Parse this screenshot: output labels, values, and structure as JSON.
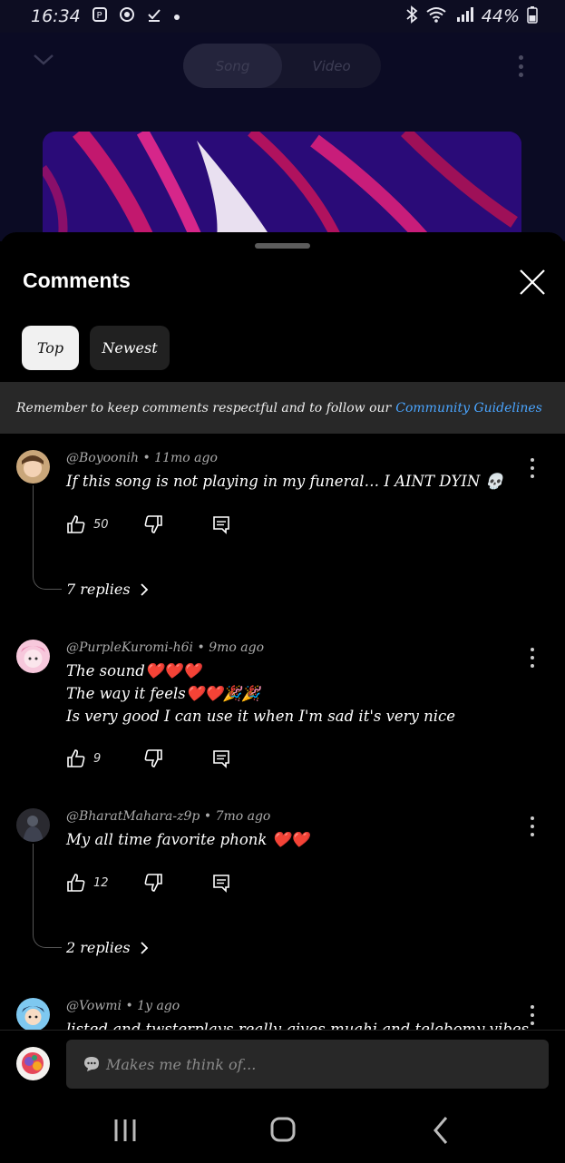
{
  "status_bar": {
    "time": "16:34",
    "battery": "44%",
    "icons": [
      "notification-p-icon",
      "circle-record-icon",
      "download-check-icon",
      "dot-icon",
      "bluetooth-icon",
      "wifi-icon",
      "signal-icon",
      "battery-icon"
    ]
  },
  "player": {
    "tabs": [
      {
        "label": "Song",
        "active": true
      },
      {
        "label": "Video",
        "active": false
      }
    ]
  },
  "comments_sheet": {
    "title": "Comments",
    "filters": [
      {
        "label": "Top",
        "selected": true
      },
      {
        "label": "Newest",
        "selected": false
      }
    ],
    "notice_text": "Remember to keep comments respectful and to follow our",
    "notice_link": "Community Guidelines",
    "comments": [
      {
        "author": "@Boyoonih",
        "age": "11mo ago",
        "lines": [
          "If this song is not playing in my funeral… I AINT DYIN 💀"
        ],
        "likes": "50",
        "replies": "7 replies"
      },
      {
        "author": "@PurpleKuromi-h6i",
        "age": "9mo ago",
        "lines": [
          "The sound❤️❤️❤️",
          "The way it feels❤️❤️🎉🎉",
          "Is very good I can use it when I'm sad it's very nice"
        ],
        "likes": "9"
      },
      {
        "author": "@BharatMahara-z9p",
        "age": "7mo ago",
        "lines": [
          "My  all time favorite phonk ❤️❤️"
        ],
        "likes": "12",
        "replies": "2 replies"
      },
      {
        "author": "@Vowmi",
        "age": "1y ago",
        "lines": [
          "listed and twsterplays really gives muahi and telebomy vibes"
        ]
      }
    ],
    "input_placeholder": "Makes me think of..."
  },
  "colors": {
    "link": "#4aa5ff",
    "chip_selected": "#f1f1f1",
    "chip_unselected": "#212121",
    "notice_bg": "#282828"
  }
}
